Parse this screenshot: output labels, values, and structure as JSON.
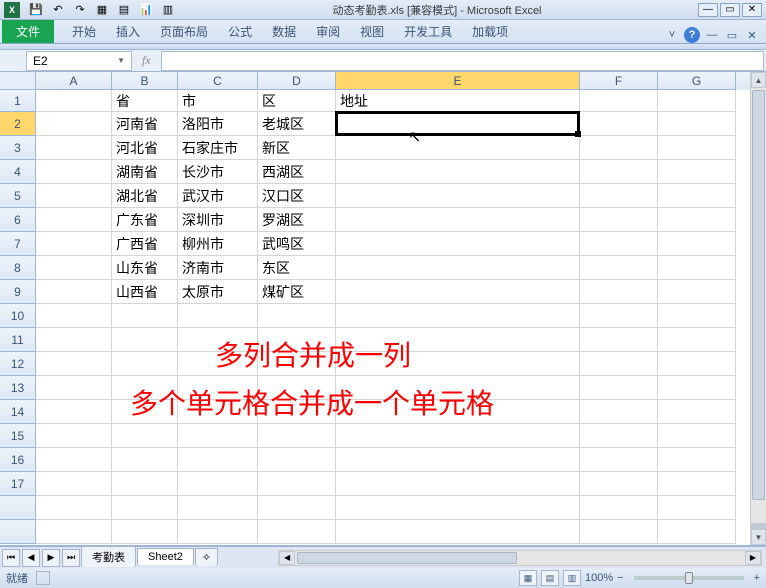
{
  "titlebar": {
    "app_icon": "X",
    "doc_title": "动态考勤表.xls  [兼容模式] - Microsoft Excel",
    "qat": {
      "save": "💾",
      "undo": "↶",
      "redo": "↷",
      "q1": "▦",
      "q2": "▤",
      "q3": "📊",
      "q4": "▥"
    },
    "win": {
      "min": "—",
      "max": "▭",
      "close": "✕"
    }
  },
  "ribbon": {
    "file": "文件",
    "tabs": [
      "开始",
      "插入",
      "页面布局",
      "公式",
      "数据",
      "审阅",
      "视图",
      "开发工具",
      "加载项"
    ],
    "right": {
      "min": "˅",
      "help": "?",
      "w1": "—",
      "w2": "▭",
      "w3": "✕"
    }
  },
  "formulabar": {
    "namebox": "E2",
    "fx": "fx",
    "formula": ""
  },
  "columns": [
    "A",
    "B",
    "C",
    "D",
    "E",
    "F",
    "G"
  ],
  "rows": [
    "1",
    "2",
    "3",
    "4",
    "5",
    "6",
    "7",
    "8",
    "9",
    "10",
    "11",
    "12",
    "13",
    "14",
    "15",
    "16",
    "17"
  ],
  "headers": {
    "B": "省",
    "C": "市",
    "D": "区",
    "E": "地址"
  },
  "data": [
    {
      "B": "河南省",
      "C": "洛阳市",
      "D": "老城区"
    },
    {
      "B": "河北省",
      "C": "石家庄市",
      "D": "新区"
    },
    {
      "B": "湖南省",
      "C": "长沙市",
      "D": "西湖区"
    },
    {
      "B": "湖北省",
      "C": "武汉市",
      "D": "汉口区"
    },
    {
      "B": "广东省",
      "C": "深圳市",
      "D": "罗湖区"
    },
    {
      "B": "广西省",
      "C": "柳州市",
      "D": "武鸣区"
    },
    {
      "B": "山东省",
      "C": "济南市",
      "D": "东区"
    },
    {
      "B": "山西省",
      "C": "太原市",
      "D": "煤矿区"
    }
  ],
  "overlay": {
    "line1": "多列合并成一列",
    "line2": "多个单元格合并成一个单元格"
  },
  "sheets": {
    "s1": "考勤表",
    "s2": "Sheet2"
  },
  "status": {
    "ready": "就绪",
    "record": "",
    "zoom": "100%",
    "minus": "−",
    "plus": "+"
  }
}
